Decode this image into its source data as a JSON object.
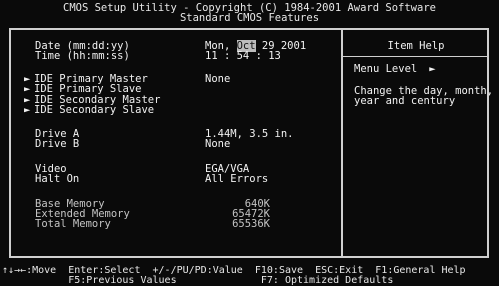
{
  "header": {
    "line1": "CMOS Setup Utility - Copyright (C) 1984-2001 Award Software",
    "line2": "Standard CMOS Features"
  },
  "date": {
    "label": "Date (mm:dd:yy)",
    "prefix": "Mon, ",
    "month": "Oct",
    "rest": " 29 2001"
  },
  "time": {
    "label": "Time (hh:mm:ss)",
    "value": "11 : 54 : 13"
  },
  "ide": [
    {
      "label": "IDE Primary Master",
      "value": "None"
    },
    {
      "label": "IDE Primary Slave",
      "value": ""
    },
    {
      "label": "IDE Secondary Master",
      "value": ""
    },
    {
      "label": "IDE Secondary Slave",
      "value": ""
    }
  ],
  "drives": [
    {
      "label": "Drive A",
      "value": "1.44M, 3.5 in."
    },
    {
      "label": "Drive B",
      "value": "None"
    }
  ],
  "video": {
    "label": "Video",
    "value": "EGA/VGA"
  },
  "halt": {
    "label": "Halt On",
    "value": "All Errors"
  },
  "memory": [
    {
      "label": "Base Memory",
      "value": "640K"
    },
    {
      "label": "Extended Memory",
      "value": "65472K"
    },
    {
      "label": "Total Memory",
      "value": "65536K"
    }
  ],
  "help": {
    "title": "Item Help",
    "menu_level": "Menu Level",
    "menu_level_marker": "►",
    "text_lines": [
      "Change the day, month,",
      "year and century"
    ]
  },
  "submenu_marker": "►",
  "footer": {
    "line1": "↑↓→←:Move  Enter:Select  +/-/PU/PD:Value  F10:Save  ESC:Exit  F1:General Help",
    "line2": "           F5:Previous Values              F7: Optimized Defaults"
  }
}
